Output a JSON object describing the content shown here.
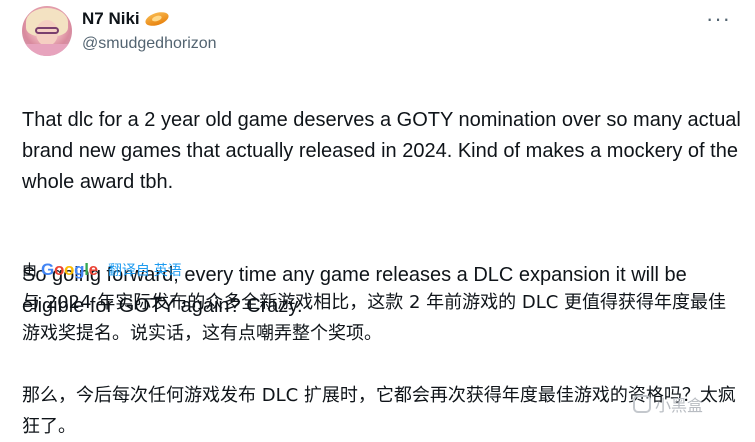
{
  "author": {
    "display_name": "N7 Niki",
    "handle": "@smudgedhorizon",
    "badge_icon": "orange-saucer-emoji"
  },
  "more_label": "···",
  "tweet": {
    "paragraph1": "That dlc for a 2 year old game deserves a GOTY nomination over so many actual brand new games that actually released in 2024. Kind of makes a mockery of the whole award tbh.",
    "paragraph2": "So going forward, every time any game releases a DLC expansion it will be eligible for GOTY again? Crazy."
  },
  "translation": {
    "by_label": "由",
    "provider": "Google",
    "translated_from": "翻译自 英语",
    "paragraph1": "与 2024 年实际发布的众多全新游戏相比，这款 2 年前游戏的 DLC 更值得获得年度最佳游戏奖提名。说实话，这有点嘲弄整个奖项。",
    "paragraph2": "那么，今后每次任何游戏发布 DLC 扩展时，它都会再次获得年度最佳游戏的资格吗？太疯狂了。"
  },
  "watermark": {
    "text": "小黑盒"
  }
}
